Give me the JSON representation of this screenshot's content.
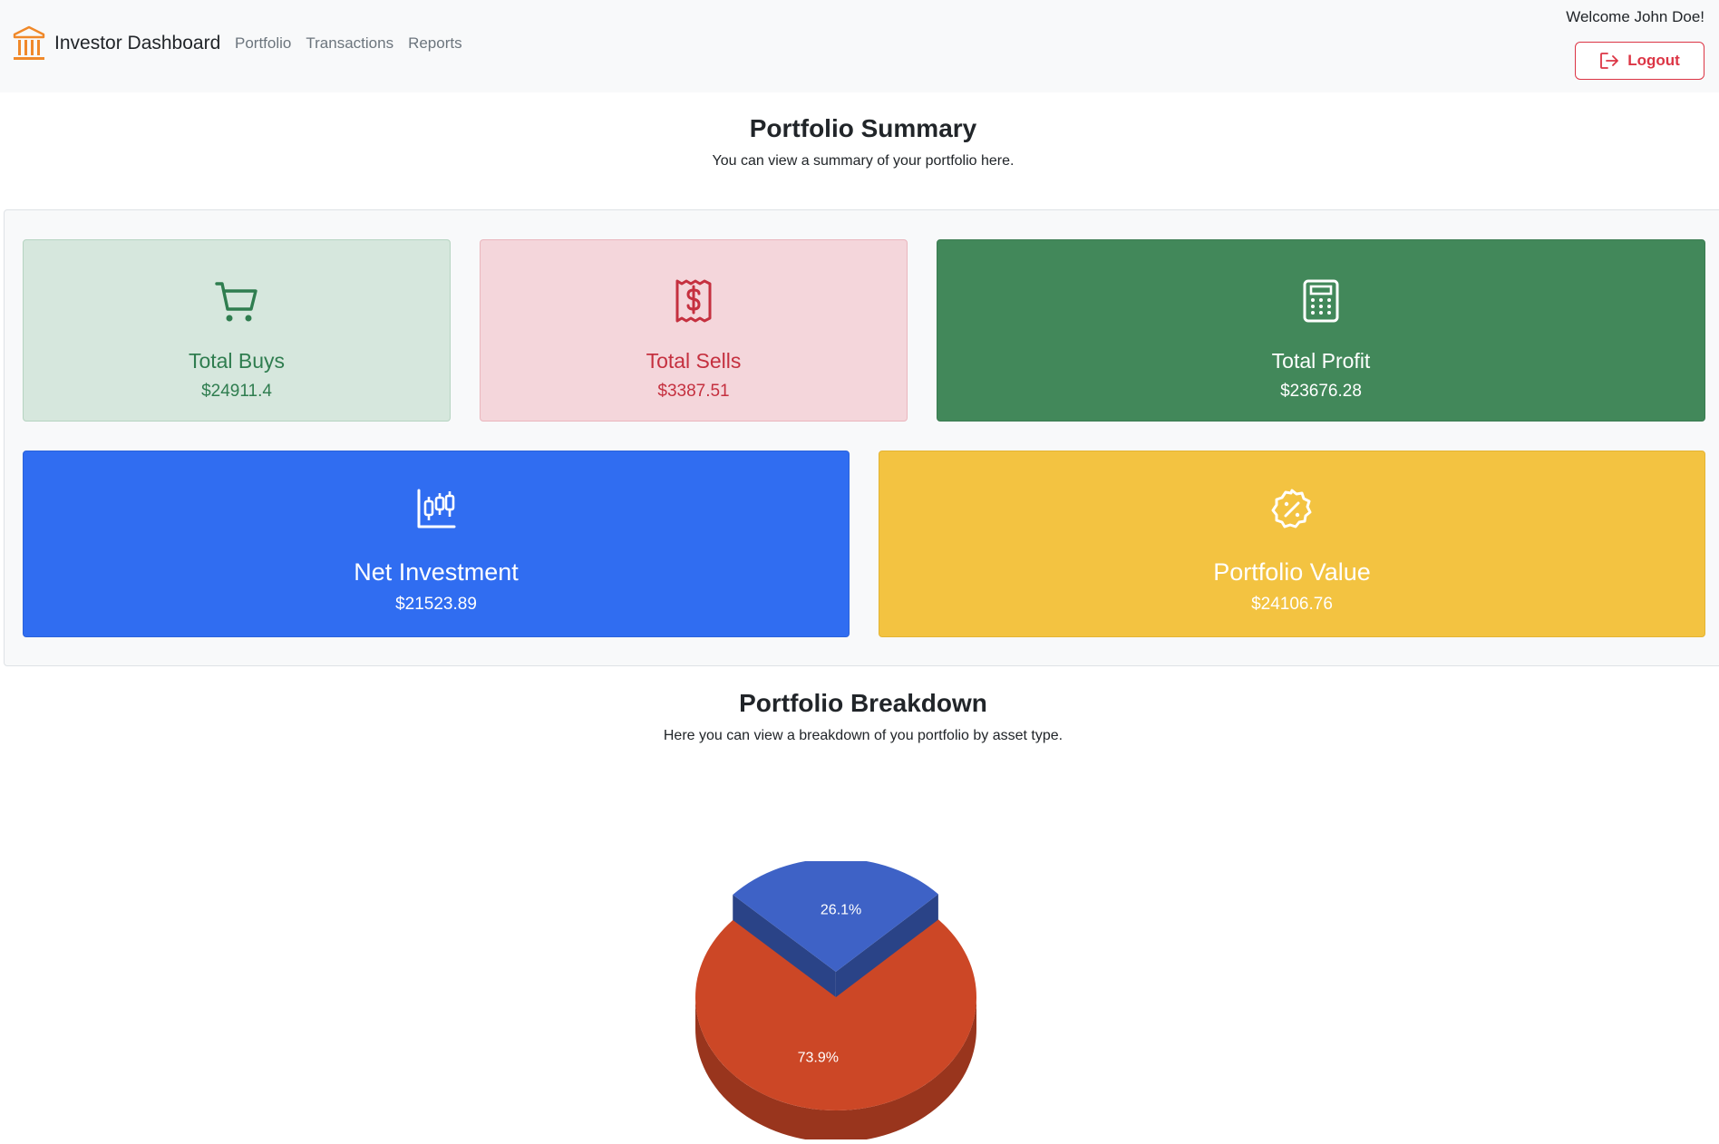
{
  "navbar": {
    "brand": "Investor Dashboard",
    "links": [
      "Portfolio",
      "Transactions",
      "Reports"
    ],
    "welcome": "Welcome John Doe!",
    "logout_label": "Logout"
  },
  "summary": {
    "title": "Portfolio Summary",
    "subtitle": "You can view a summary of your portfolio here.",
    "cards": [
      {
        "label": "Total Buys",
        "value": "$24911.4",
        "icon": "cart-icon",
        "color": "#2f7d4f"
      },
      {
        "label": "Total Sells",
        "value": "$3387.51",
        "icon": "receipt-dollar-icon",
        "color": "#c5303f"
      },
      {
        "label": "Total Profit",
        "value": "$23676.28",
        "icon": "calculator-icon",
        "color": "#42885a"
      },
      {
        "label": "Net Investment",
        "value": "$21523.89",
        "icon": "candlestick-chart-icon",
        "color": "#306df1"
      },
      {
        "label": "Portfolio Value",
        "value": "$24106.76",
        "icon": "percent-badge-icon",
        "color": "#f3c341"
      }
    ]
  },
  "breakdown": {
    "title": "Portfolio Breakdown",
    "subtitle": "Here you can view a breakdown of you portfolio by asset type."
  },
  "chart_data": {
    "type": "pie",
    "values": [
      73.9,
      26.1
    ],
    "labels": [
      "73.9%",
      "26.1%"
    ],
    "colors": [
      "#cc4726",
      "#3e62c6"
    ],
    "three_d": true,
    "exploded_slice": 1
  }
}
